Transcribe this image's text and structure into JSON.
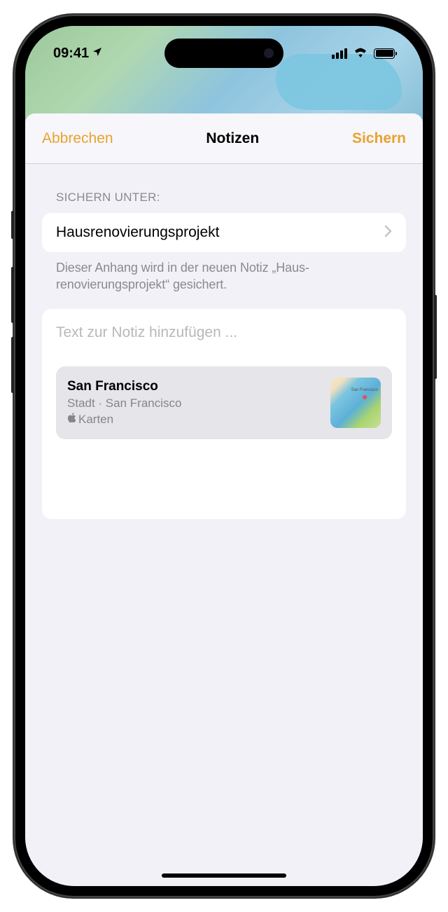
{
  "statusBar": {
    "time": "09:41"
  },
  "header": {
    "cancel": "Abbrechen",
    "title": "Notizen",
    "save": "Sichern"
  },
  "form": {
    "sectionLabel": "SICHERN UNTER:",
    "selectedFolder": "Hausrenovierungsprojekt",
    "helperText": "Dieser Anhang wird in der neuen Notiz „Haus­renovierungsprojekt“ gesichert.",
    "notePlaceholder": "Text zur Notiz hinzufügen ..."
  },
  "attachment": {
    "title": "San Francisco",
    "subtitle": "Stadt · San Francisco",
    "source": "Karten",
    "thumbLabel": "San Francisco"
  }
}
